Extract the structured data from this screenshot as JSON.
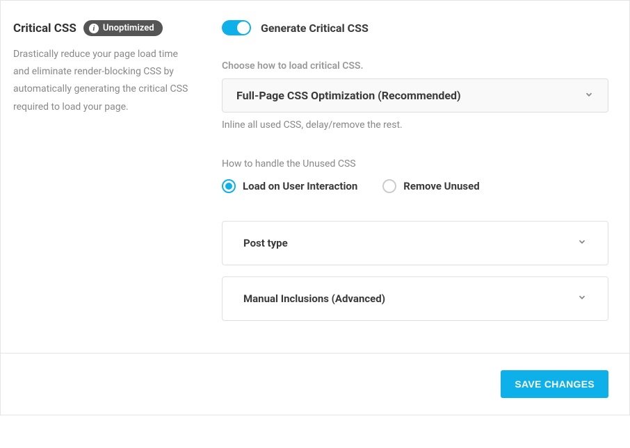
{
  "sidebar": {
    "title": "Critical CSS",
    "badge": "Unoptimized",
    "description": "Drastically reduce your page load time and eliminate render-blocking CSS by automatically generating the critical CSS required to load your page."
  },
  "settings": {
    "toggle_label": "Generate Critical CSS",
    "load_method_label": "Choose how to load critical CSS.",
    "load_method_selected": "Full-Page CSS Optimization (Recommended)",
    "load_method_help": "Inline all used CSS, delay/remove the rest.",
    "unused_css_label": "How to handle the Unused CSS",
    "unused_css_options": [
      {
        "label": "Load on User Interaction",
        "selected": true
      },
      {
        "label": "Remove Unused",
        "selected": false
      }
    ],
    "accordions": [
      {
        "title": "Post type"
      },
      {
        "title": "Manual Inclusions (Advanced)"
      }
    ]
  },
  "footer": {
    "save_label": "SAVE CHANGES"
  }
}
